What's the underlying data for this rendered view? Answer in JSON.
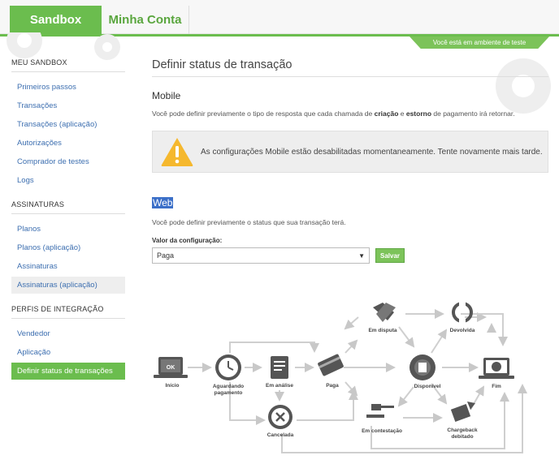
{
  "header": {
    "brand": "Sandbox",
    "account": "Minha Conta",
    "env_badge": "Você está em ambiente de teste"
  },
  "sidebar": {
    "sections": [
      {
        "title": "MEU SANDBOX",
        "items": [
          "Primeiros passos",
          "Transações",
          "Transações (aplicação)",
          "Autorizações",
          "Comprador de testes",
          "Logs"
        ]
      },
      {
        "title": "ASSINATURAS",
        "items": [
          "Planos",
          "Planos (aplicação)",
          "Assinaturas",
          "Assinaturas (aplicação)"
        ]
      },
      {
        "title": "PERFIS DE INTEGRAÇÃO",
        "items": [
          "Vendedor",
          "Aplicação",
          "Definir status de transações"
        ]
      }
    ]
  },
  "main": {
    "title": "Definir status de transação",
    "mobile": {
      "heading": "Mobile",
      "desc_part1": "Você pode definir previamente o tipo de resposta que cada chamada de ",
      "desc_bold1": "criação",
      "desc_part2": " e ",
      "desc_bold2": "estorno",
      "desc_part3": " de pagamento irá retornar.",
      "warning": "As configurações Mobile estão desabilitadas momentaneamente. Tente novamente mais tarde."
    },
    "web": {
      "heading": "Web",
      "desc": "Você pode definir previamente o status que sua transação terá.",
      "config_label": "Valor da configuração:",
      "config_value": "Paga",
      "save_label": "Salvar"
    }
  },
  "diagram": {
    "labels": {
      "inicio": "Início",
      "aguardando1": "Aguardando",
      "aguardando2": "pagamento",
      "em_analise": "Em análise",
      "paga": "Paga",
      "cancelada": "Cancelada",
      "em_disputa": "Em disputa",
      "devolvida": "Devolvida",
      "disponivel": "Disponível",
      "fim": "Fim",
      "em_contestacao": "Em contestação",
      "chargeback1": "Chargeback",
      "chargeback2": "debitado",
      "ok": "OK"
    }
  }
}
